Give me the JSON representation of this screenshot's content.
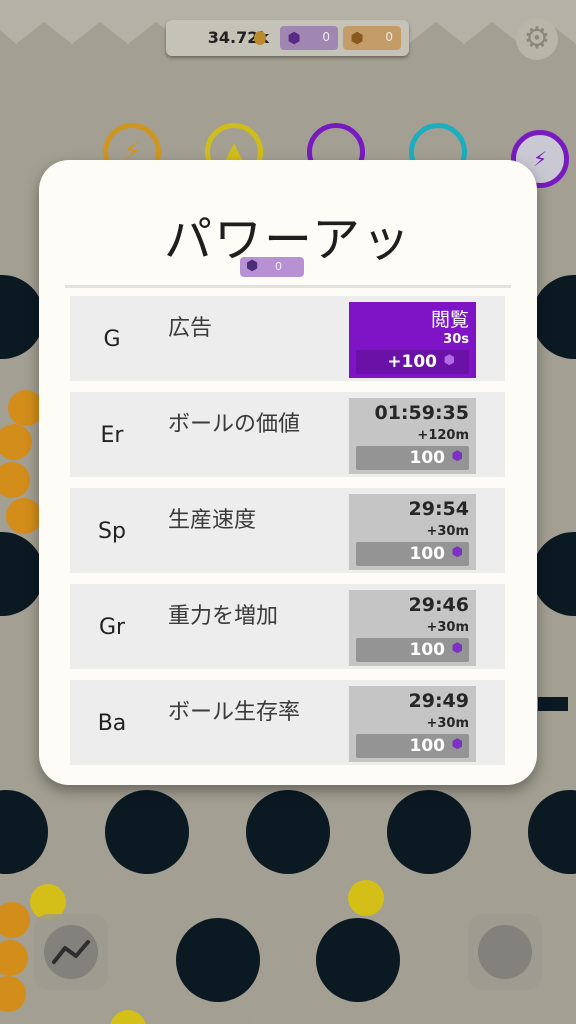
{
  "hud": {
    "coins": "34.72k",
    "gems_purple": "0",
    "gems_orange": "0"
  },
  "modal": {
    "title": "パワーアッ",
    "gem_balance": "0",
    "rows": [
      {
        "symbol": "G",
        "name": "広告",
        "timer": "閲覧",
        "delta": "30s",
        "cost": "+100",
        "style": "ad"
      },
      {
        "symbol": "Er",
        "name": "ボールの価値",
        "timer": "01:59:35",
        "delta": "+120m",
        "cost": "100",
        "style": "normal"
      },
      {
        "symbol": "Sp",
        "name": "生産速度",
        "timer": "29:54",
        "delta": "+30m",
        "cost": "100",
        "style": "normal"
      },
      {
        "symbol": "Gr",
        "name": "重力を増加",
        "timer": "29:46",
        "delta": "+30m",
        "cost": "100",
        "style": "normal"
      },
      {
        "symbol": "Ba",
        "name": "ボール生存率",
        "timer": "29:49",
        "delta": "+30m",
        "cost": "100",
        "style": "normal"
      }
    ]
  },
  "colors": {
    "accent_purple": "#7f14c7",
    "peg_color": "#0c1a24",
    "ball_orange": "#d7901b",
    "ball_yellow": "#d8c318"
  },
  "icons": {
    "settings": "gear-icon",
    "stats": "chart-line-icon",
    "gem": "gem-icon",
    "coin": "coin-icon"
  }
}
